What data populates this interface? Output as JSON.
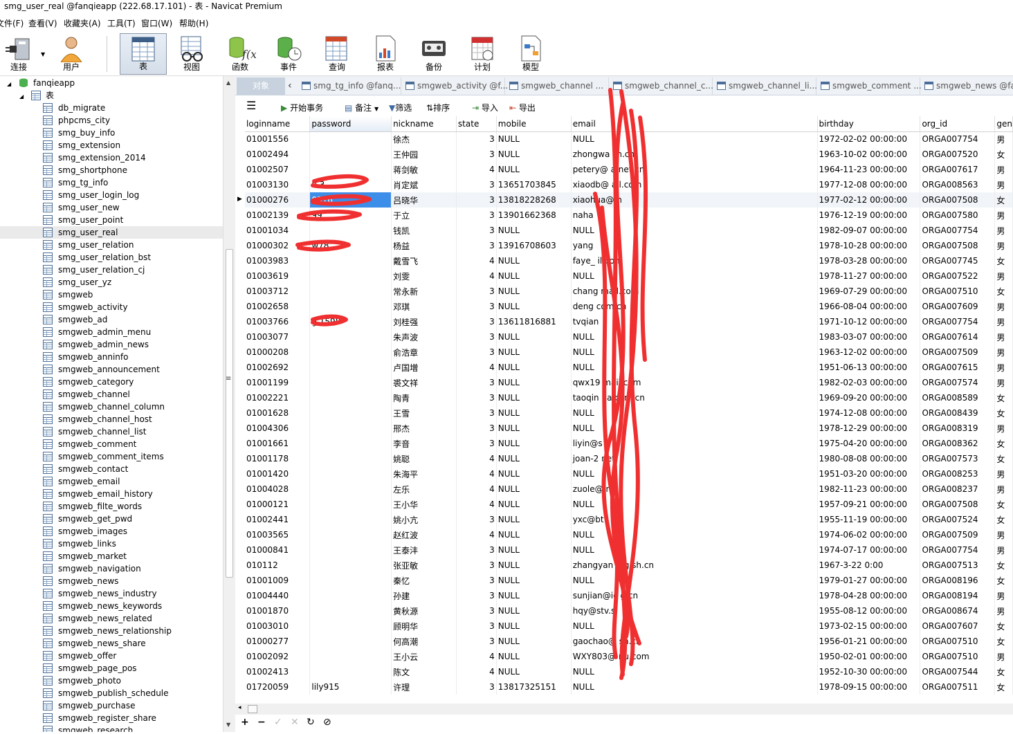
{
  "window": {
    "title": "smg_user_real @fanqieapp (222.68.17.101) - 表 - Navicat Premium"
  },
  "menu": [
    "文件(F)",
    "查看(V)",
    "收藏夹(A)",
    "工具(T)",
    "窗口(W)",
    "帮助(H)"
  ],
  "toolbar": {
    "connect": "连接",
    "user": "用户",
    "table": "表",
    "view": "视图",
    "function": "函数",
    "event": "事件",
    "query": "查询",
    "report": "报表",
    "backup": "备份",
    "schedule": "计划",
    "model": "模型"
  },
  "tree": {
    "connection": "fanqieapp",
    "group": "表",
    "selected": "smg_user_real",
    "tables": [
      "db_migrate",
      "phpcms_city",
      "smg_buy_info",
      "smg_extension",
      "smg_extension_2014",
      "smg_shortphone",
      "smg_tg_info",
      "smg_user_login_log",
      "smg_user_new",
      "smg_user_point",
      "smg_user_real",
      "smg_user_relation",
      "smg_user_relation_bst",
      "smg_user_relation_cj",
      "smg_user_yz",
      "smgweb",
      "smgweb_activity",
      "smgweb_ad",
      "smgweb_admin_menu",
      "smgweb_admin_news",
      "smgweb_anninfo",
      "smgweb_announcement",
      "smgweb_category",
      "smgweb_channel",
      "smgweb_channel_column",
      "smgweb_channel_host",
      "smgweb_channel_list",
      "smgweb_comment",
      "smgweb_comment_items",
      "smgweb_contact",
      "smgweb_email",
      "smgweb_email_history",
      "smgweb_filte_words",
      "smgweb_get_pwd",
      "smgweb_images",
      "smgweb_links",
      "smgweb_market",
      "smgweb_navigation",
      "smgweb_news",
      "smgweb_news_industry",
      "smgweb_news_keywords",
      "smgweb_news_related",
      "smgweb_news_relationship",
      "smgweb_news_share",
      "smgweb_offer",
      "smgweb_page_pos",
      "smgweb_photo",
      "smgweb_publish_schedule",
      "smgweb_purchase",
      "smgweb_register_share",
      "smgweb_research"
    ]
  },
  "tabs": {
    "objects": "对象",
    "items": [
      "smg_tg_info @fanq...",
      "smgweb_activity @f...",
      "smgweb_channel ...",
      "smgweb_channel_c...",
      "smgweb_channel_li...",
      "smgweb_comment ...",
      "smgweb_news @fa..."
    ]
  },
  "actions": {
    "begin": "开始事务",
    "memo": "备注",
    "filter": "筛选",
    "sort": "排序",
    "import": "导入",
    "export": "导出"
  },
  "grid": {
    "columns": [
      "loginname",
      "password",
      "nickname",
      "state",
      "mobile",
      "email",
      "birthday",
      "org_id",
      "gen"
    ],
    "rows": [
      [
        "01001556",
        "",
        "徐杰",
        "3",
        "NULL",
        "NULL",
        "1972-02-02 00:00:00",
        "ORGA007754",
        "男"
      ],
      [
        "01002494",
        "",
        "王仲园",
        "3",
        "NULL",
        "zhongwa           sh.cn",
        "1963-10-02 00:00:00",
        "ORGA007520",
        "女"
      ],
      [
        "01002507",
        "",
        "蒋剑敏",
        "4",
        "NULL",
        "petery@           a.net.cn",
        "1964-11-23 00:00:00",
        "ORGA007617",
        "男"
      ],
      [
        "01003130",
        "u          3",
        "肖定斌",
        "3",
        "13651703845",
        "xiaodb@          ail.com",
        "1977-12-08 00:00:00",
        "ORGA008563",
        "男"
      ],
      [
        "01000276",
        "          0316",
        "吕晓华",
        "3",
        "13818228268",
        "xiaohua@          n",
        "1977-02-12 00:00:00",
        "ORGA007508",
        "女"
      ],
      [
        "01002139",
        "          99",
        "于立",
        "3",
        "13901662368",
        "naha",
        "1976-12-19 00:00:00",
        "ORGA007580",
        "男"
      ],
      [
        "01001034",
        "",
        "钱凯",
        "3",
        "NULL",
        "NULL",
        "1982-09-07 00:00:00",
        "ORGA007754",
        "男"
      ],
      [
        "01000302",
        "w78",
        "杨益",
        "3",
        "13916708603",
        "yang",
        "1978-10-28 00:00:00",
        "ORGA007508",
        "男"
      ],
      [
        "01003983",
        "",
        "戴雪飞",
        "4",
        "NULL",
        "faye_           il.com",
        "1978-03-28 00:00:00",
        "ORGA007745",
        "女"
      ],
      [
        "01003619",
        "",
        "刘雯",
        "4",
        "NULL",
        "NULL",
        "1978-11-27 00:00:00",
        "ORGA007522",
        "男"
      ],
      [
        "01003712",
        "",
        "常永新",
        "3",
        "NULL",
        "chang            mail.com",
        "1969-07-29 00:00:00",
        "ORGA007510",
        "女"
      ],
      [
        "01002658",
        "",
        "邓琪",
        "3",
        "NULL",
        "deng            com.cn",
        "1966-08-04 00:00:00",
        "ORGA007609",
        "男"
      ],
      [
        "01003766",
        "g        1598",
        "刘桂强",
        "3",
        "13611816881",
        "tvqian",
        "1971-10-12 00:00:00",
        "ORGA007754",
        "男"
      ],
      [
        "01003077",
        "",
        "朱声波",
        "3",
        "NULL",
        "NULL",
        "1983-03-07 00:00:00",
        "ORGA007614",
        "男"
      ],
      [
        "01000208",
        "",
        "俞浩章",
        "3",
        "NULL",
        "NULL",
        "1963-12-02 00:00:00",
        "ORGA007509",
        "男"
      ],
      [
        "01002692",
        "",
        "卢国増",
        "4",
        "NULL",
        "NULL",
        "1951-06-13 00:00:00",
        "ORGA007615",
        "男"
      ],
      [
        "01001199",
        "",
        "裘文祥",
        "3",
        "NULL",
        "qwx19           mail.com",
        "1982-02-03 00:00:00",
        "ORGA007574",
        "男"
      ],
      [
        "01002221",
        "",
        "陶青",
        "3",
        "NULL",
        "taoqin           ha.com.cn",
        "1969-09-20 00:00:00",
        "ORGA008589",
        "女"
      ],
      [
        "01001628",
        "",
        "王雪",
        "3",
        "NULL",
        "NULL",
        "1974-12-08 00:00:00",
        "ORGA008439",
        "女"
      ],
      [
        "01004306",
        "",
        "邢杰",
        "3",
        "NULL",
        "NULL",
        "1978-12-29 00:00:00",
        "ORGA008319",
        "男"
      ],
      [
        "01001661",
        "",
        "李音",
        "3",
        "NULL",
        "liyin@s",
        "1975-04-20 00:00:00",
        "ORGA008362",
        "女"
      ],
      [
        "01001178",
        "",
        "姚聪",
        "4",
        "NULL",
        "joan-2           net",
        "1980-08-08 00:00:00",
        "ORGA007573",
        "女"
      ],
      [
        "01001420",
        "",
        "朱海平",
        "4",
        "NULL",
        "NULL",
        "1951-03-20 00:00:00",
        "ORGA008253",
        "男"
      ],
      [
        "01004028",
        "",
        "左乐",
        "4",
        "NULL",
        "zuole@            n",
        "1982-11-23 00:00:00",
        "ORGA008237",
        "男"
      ],
      [
        "01000121",
        "",
        "王小华",
        "4",
        "NULL",
        "NULL",
        "1957-09-21 00:00:00",
        "ORGA007508",
        "女"
      ],
      [
        "01002441",
        "",
        "姚小亢",
        "3",
        "NULL",
        "yxc@bt",
        "1955-11-19 00:00:00",
        "ORGA007524",
        "女"
      ],
      [
        "01003565",
        "",
        "赵红波",
        "4",
        "NULL",
        "NULL",
        "1974-06-02 00:00:00",
        "ORGA007509",
        "男"
      ],
      [
        "01000841",
        "",
        "王泰沣",
        "3",
        "NULL",
        "NULL",
        "1974-07-17 00:00:00",
        "ORGA007754",
        "男"
      ],
      [
        "010112",
        "",
        "张亚敏",
        "3",
        "NULL",
        "zhangyan           mg.sh.cn",
        "1967-3-22 0:00",
        "ORGA007513",
        "女"
      ],
      [
        "01001009",
        "",
        "秦忆",
        "3",
        "NULL",
        "NULL",
        "1979-01-27 00:00:00",
        "ORGA008196",
        "女"
      ],
      [
        "01004440",
        "",
        "孙建",
        "3",
        "NULL",
        "sunjian@ic          g.cn",
        "1978-04-28 00:00:00",
        "ORGA008194",
        "男"
      ],
      [
        "01001870",
        "",
        "黄秋源",
        "3",
        "NULL",
        "hqy@stv.s",
        "1955-08-12 00:00:00",
        "ORGA008674",
        "男"
      ],
      [
        "01003010",
        "",
        "顾明华",
        "3",
        "NULL",
        "NULL",
        "1973-02-15 00:00:00",
        "ORGA007607",
        "女"
      ],
      [
        "01000277",
        "",
        "何高潮",
        "3",
        "NULL",
        "gaochao@          sh.cn",
        "1956-01-21 00:00:00",
        "ORGA007510",
        "女"
      ],
      [
        "01002092",
        "",
        "王小云",
        "4",
        "NULL",
        "WXY803@          nu.com",
        "1950-02-01 00:00:00",
        "ORGA007510",
        "男"
      ],
      [
        "01002413",
        "",
        "陈文",
        "4",
        "NULL",
        "NULL",
        "1952-10-30 00:00:00",
        "ORGA007544",
        "女"
      ],
      [
        "01720059",
        "lily915",
        "许理",
        "3",
        "13817325151",
        "NULL",
        "1978-09-15 00:00:00",
        "ORGA007511",
        "女"
      ]
    ]
  }
}
